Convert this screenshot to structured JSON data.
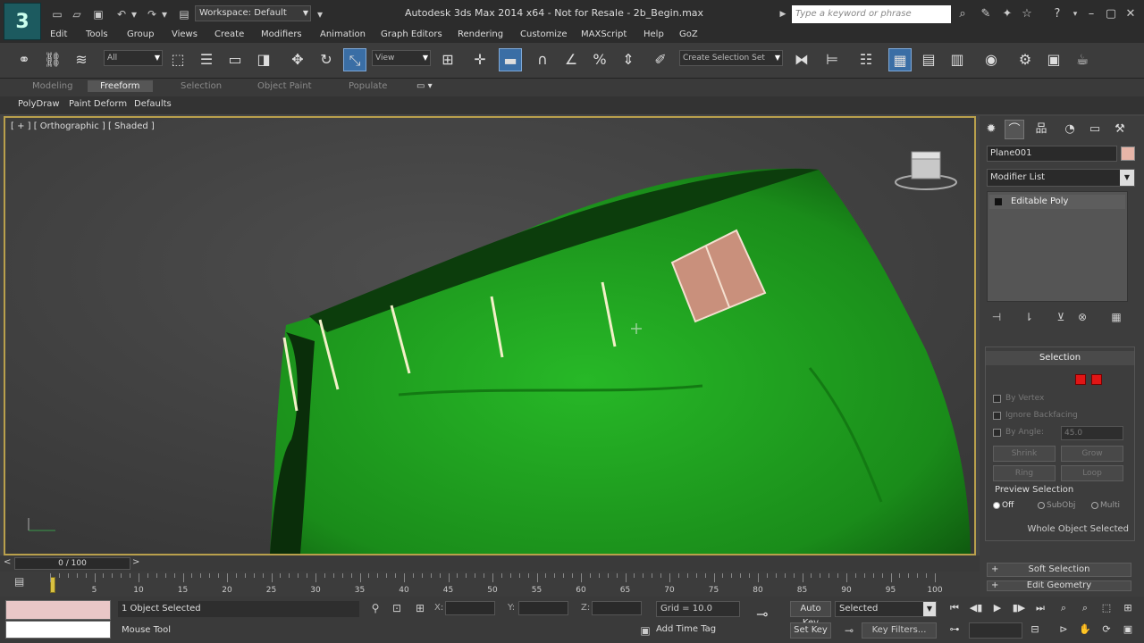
{
  "app": {
    "title": "Autodesk 3ds Max  2014 x64    - Not for Resale -  2b_Begin.max",
    "logo": "3",
    "workspace": "Workspace: Default",
    "search_placeholder": "Type a keyword or phrase"
  },
  "menu": [
    "Edit",
    "Tools",
    "Group",
    "Views",
    "Create",
    "Modifiers",
    "Animation",
    "Graph Editors",
    "Rendering",
    "Customize",
    "MAXScript",
    "Help",
    "GoZ"
  ],
  "toolbar": {
    "filter_value": "All",
    "ref_coord_value": "View",
    "named_selection_placeholder": "Create Selection Set"
  },
  "ribbon": {
    "tabs": [
      "Modeling",
      "Freeform",
      "Selection",
      "Object Paint",
      "Populate"
    ],
    "active_tab": "Freeform",
    "sub_items": [
      "PolyDraw",
      "Paint Deform",
      "Defaults"
    ]
  },
  "viewport": {
    "label": "[ + ] [ Orthographic ] [ Shaded ]",
    "mesh_color": "#1f9c1f",
    "selected_face_color": "#c9907c",
    "frame_color": "#b9a04c"
  },
  "command_panel": {
    "object_name": "Plane001",
    "object_color": "#e7b5a8",
    "modifier_list": "Modifier List",
    "stack_item": "Editable Poly",
    "selection_rollout": {
      "title": "Selection",
      "checks": [
        "By Vertex",
        "Ignore Backfacing",
        "By Angle:"
      ],
      "angle_value": "45.0",
      "buttons": [
        "Shrink",
        "Grow",
        "Ring",
        "Loop"
      ],
      "preview_label": "Preview Selection",
      "preview_options": [
        "Off",
        "SubObj",
        "Multi"
      ],
      "preview_selected": "Off",
      "status": "Whole Object Selected"
    },
    "rollouts": [
      "Soft Selection",
      "Edit Geometry"
    ]
  },
  "timeline": {
    "slider_label": "0 / 100",
    "nav_left": "<",
    "nav_right": ">",
    "ticks": [
      5,
      10,
      15,
      20,
      25,
      30,
      35,
      40,
      45,
      50,
      55,
      60,
      65,
      70,
      75,
      80,
      85,
      90,
      95,
      100
    ]
  },
  "status": {
    "selection": "1 Object Selected",
    "prompt": "Mouse Tool",
    "coord_labels": [
      "X:",
      "Y:",
      "Z:"
    ],
    "grid": "Grid = 10.0",
    "add_time_tag": "Add Time Tag",
    "auto_key": "Auto Key",
    "set_key": "Set Key",
    "key_mode": "Selected",
    "key_filters": "Key Filters..."
  }
}
